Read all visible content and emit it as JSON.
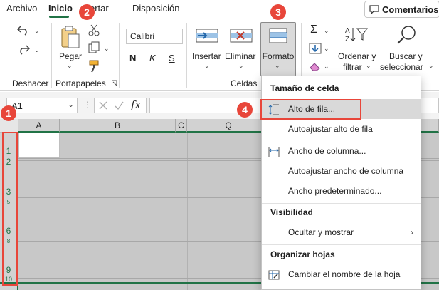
{
  "tabs": [
    {
      "label": "Archivo"
    },
    {
      "label": "Inicio",
      "active": true
    },
    {
      "label": "ertar"
    },
    {
      "label": "Disposición"
    }
  ],
  "comments_label": "Comentarios",
  "ribbon": {
    "font_name": "Calibri",
    "font_buttons": [
      "N",
      "K",
      "S"
    ],
    "paste_label": "Pegar",
    "insert_label": "Insertar",
    "delete_label": "Eliminar",
    "format_label": "Formato",
    "sort_label_1": "Ordenar y",
    "sort_label_2": "filtrar",
    "find_label_1": "Buscar y",
    "find_label_2": "seleccionar",
    "groups": {
      "undo": "Deshacer",
      "clipboard": "Portapapeles",
      "cells": "Celdas"
    }
  },
  "formula_bar": {
    "name_box": "A1",
    "fx": "fx",
    "formula": ""
  },
  "grid": {
    "columns": [
      "A",
      "B",
      "C",
      "Q"
    ],
    "rows": [
      "1",
      "2",
      "3",
      "5",
      "6",
      "8",
      "9",
      "10"
    ]
  },
  "format_menu": {
    "section_cell_size": "Tamaño de celda",
    "row_height": "Alto de fila...",
    "autofit_row_height": "Autoajustar alto de fila",
    "column_width": "Ancho de columna...",
    "autofit_column_width": "Autoajustar ancho de columna",
    "default_width": "Ancho predeterminado...",
    "section_visibility": "Visibilidad",
    "hide_unhide": "Ocultar y mostrar",
    "section_organize": "Organizar hojas",
    "rename_sheet": "Cambiar el nombre de la hoja"
  },
  "callouts": [
    "1",
    "2",
    "3",
    "4"
  ],
  "colors": {
    "accent_green": "#217346",
    "callout_red": "#e8463a",
    "selection_gray": "#c8c8c8"
  }
}
